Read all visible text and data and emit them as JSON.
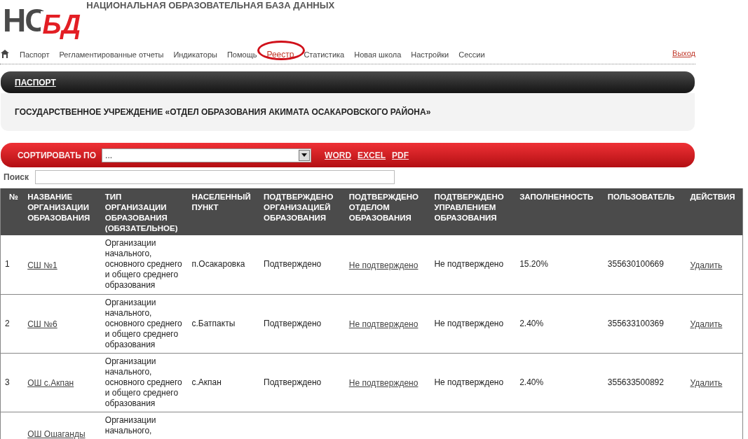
{
  "logo": {
    "left": "НС",
    "right": "БД"
  },
  "site_title": "НАЦИОНАЛЬНАЯ ОБРАЗОВАТЕЛЬНАЯ БАЗА ДАННЫХ",
  "nav": [
    {
      "label": "Паспорт",
      "selected": false
    },
    {
      "label": "Регламентированные отчеты",
      "selected": false
    },
    {
      "label": "Индикаторы",
      "selected": false
    },
    {
      "label": "Помощь",
      "selected": false
    },
    {
      "label": "Реестр",
      "selected": true
    },
    {
      "label": "Статистика",
      "selected": false
    },
    {
      "label": "Новая школа",
      "selected": false
    },
    {
      "label": "Настройки",
      "selected": false
    },
    {
      "label": "Сессии",
      "selected": false
    }
  ],
  "logout": "Выход",
  "section_bar": {
    "title": "ПАСПОРТ"
  },
  "organization": "ГОСУДАРСТВЕННОЕ УЧРЕЖДЕНИЕ «ОТДЕЛ ОБРАЗОВАНИЯ АКИМАТА ОСАКАРОВСКОГО РАЙОНА»",
  "sort_bar": {
    "label": "СОРТИРОВАТЬ ПО",
    "value": "...",
    "exports": [
      "WORD",
      "EXCEL",
      "PDF"
    ]
  },
  "search": {
    "label": "Поиск"
  },
  "table": {
    "columns": [
      "№",
      "НАЗВАНИЕ ОРГАНИЗАЦИИ ОБРАЗОВАНИЯ",
      "ТИП ОРГАНИЗАЦИИ ОБРАЗОВАНИЯ (ОБЯЗАТЕЛЬНОЕ)",
      "НАСЕЛЕННЫЙ ПУНКТ",
      "ПОДТВЕРЖДЕНО ОРГАНИЗАЦИЕЙ ОБРАЗОВАНИЯ",
      "ПОДТВЕРЖДЕНО ОТДЕЛОМ ОБРАЗОВАНИЯ",
      "ПОДТВЕРЖДЕНО УПРАВЛЕНИЕМ ОБРАЗОВАНИЯ",
      "ЗАПОЛНЕННОСТЬ",
      "ПОЛЬЗОВАТЕЛЬ",
      "ДЕЙСТВИЯ"
    ],
    "rows": [
      [
        "1",
        "СШ №1",
        "Организации начального, основного среднего и общего среднего образования",
        "п.Осакаровка",
        "Подтверждено",
        "Не подтверждено",
        "Не подтверждено",
        "15.20%",
        "355630100669",
        "Удалить"
      ],
      [
        "2",
        "СШ №6",
        "Организации начального, основного среднего и общего среднего образования",
        "с.Батпакты",
        "Подтверждено",
        "Не подтверждено",
        "Не подтверждено",
        "2.40%",
        "355633100369",
        "Удалить"
      ],
      [
        "3",
        "ОШ с.Акпан",
        "Организации начального, основного среднего и общего среднего образования",
        "с.Акпан",
        "Подтверждено",
        "Не подтверждено",
        "Не подтверждено",
        "2.40%",
        "355633500892",
        "Удалить"
      ],
      [
        "",
        "ОШ Ошаганды",
        "Организации начального,",
        "",
        "",
        "",
        "",
        "",
        "",
        ""
      ]
    ]
  }
}
